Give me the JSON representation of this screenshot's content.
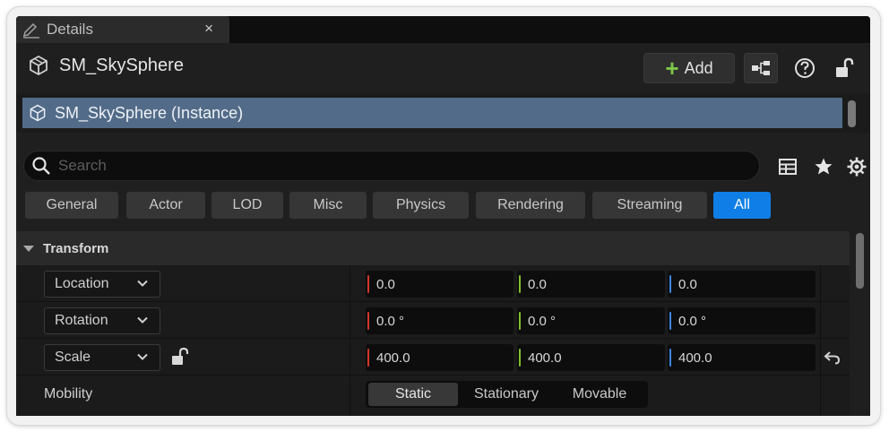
{
  "tab": {
    "title": "Details",
    "close": "×"
  },
  "header": {
    "object_name": "SM_SkySphere",
    "add_label": "Add"
  },
  "instance": {
    "label": "SM_SkySphere (Instance)"
  },
  "search": {
    "placeholder": "Search",
    "value": ""
  },
  "filters": [
    "General",
    "Actor",
    "LOD",
    "Misc",
    "Physics",
    "Rendering",
    "Streaming",
    "All"
  ],
  "active_filter": "All",
  "section": {
    "title": "Transform"
  },
  "transform": {
    "location": {
      "label": "Location",
      "x": "0.0",
      "y": "0.0",
      "z": "0.0"
    },
    "rotation": {
      "label": "Rotation",
      "x": "0.0 °",
      "y": "0.0 °",
      "z": "0.0 °"
    },
    "scale": {
      "label": "Scale",
      "x": "400.0",
      "y": "400.0",
      "z": "400.0"
    },
    "mobility": {
      "label": "Mobility",
      "options": [
        "Static",
        "Stationary",
        "Movable"
      ],
      "selected": "Static"
    }
  },
  "colors": {
    "accent": "#0f7ee6",
    "selection": "#526b88",
    "axis_x": "#d2382c",
    "axis_y": "#7fbf2a",
    "axis_z": "#3d85e0",
    "add_plus": "#7ec74a"
  },
  "icons": [
    "edit-icon",
    "close-icon",
    "static-mesh-icon",
    "plus-icon",
    "blueprint-icon",
    "help-icon",
    "unlock-icon",
    "search-icon",
    "grid-view-icon",
    "star-icon",
    "gear-icon",
    "chevron-down-icon",
    "reset-icon"
  ]
}
